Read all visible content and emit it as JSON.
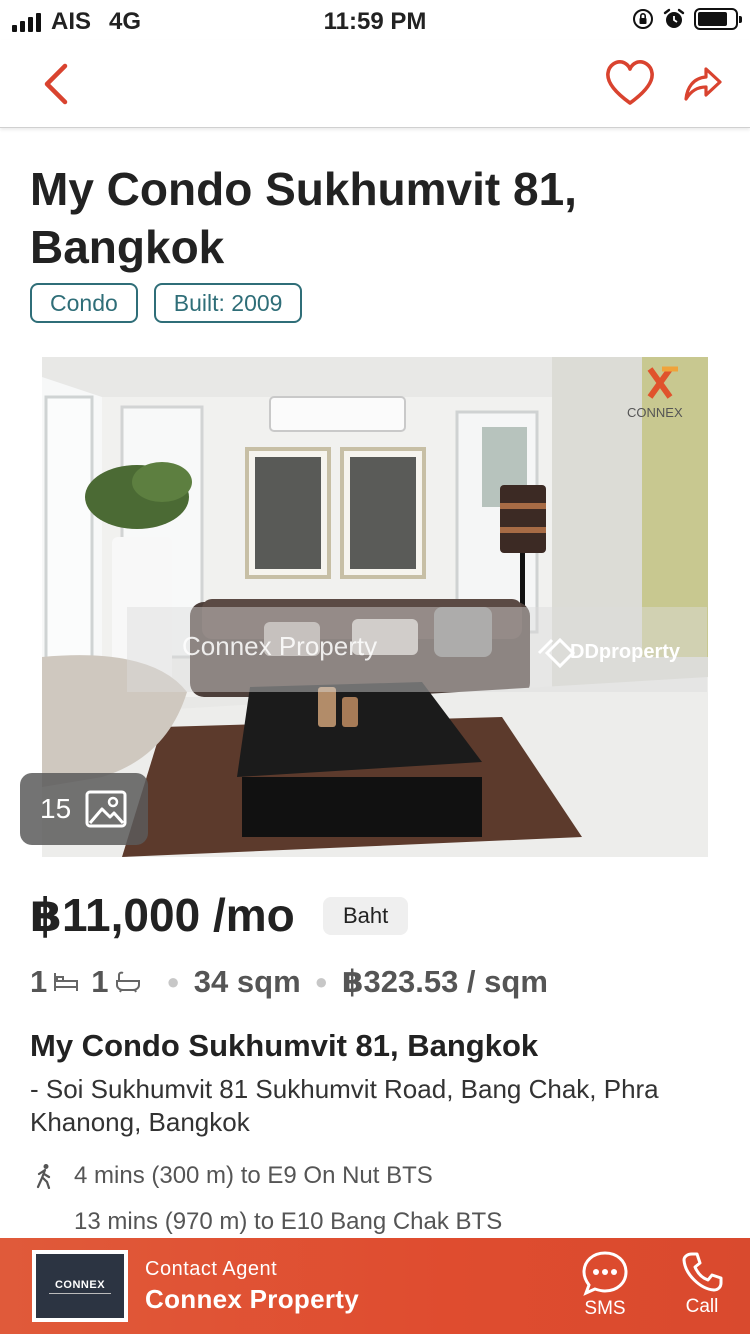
{
  "status_bar": {
    "carrier": "AIS",
    "network": "4G",
    "time": "11:59 PM"
  },
  "nav": {
    "back_icon": "chevron-left-icon",
    "favorite_icon": "heart-icon",
    "share_icon": "share-arrow-icon",
    "accent_color": "#d9432f"
  },
  "listing": {
    "title": "My Condo Sukhumvit 81, Bangkok",
    "tags": [
      "Condo",
      "Built: 2009"
    ],
    "photo": {
      "count": "15",
      "watermark_left": "Connex Property",
      "watermark_right": "DDproperty",
      "logo_text": "CONNEX"
    },
    "price": "฿11,000 /mo",
    "currency_chip": "Baht",
    "specs": {
      "bedrooms": "1",
      "bathrooms": "1",
      "area": "34 sqm",
      "price_per_sqm": "฿323.53 / sqm"
    },
    "project_name": "My Condo Sukhumvit 81, Bangkok",
    "address": "- Soi Sukhumvit 81 Sukhumvit Road, Bang Chak, Phra Khanong, Bangkok",
    "transit": [
      "4 mins (300 m) to E9 On Nut BTS",
      "13 mins (970 m) to E10 Bang Chak BTS"
    ]
  },
  "contact": {
    "caption": "Contact Agent",
    "agent_name": "Connex Property",
    "logo_text": "CONNEX",
    "sms_label": "SMS",
    "call_label": "Call",
    "bar_color": "#df4c2f"
  }
}
